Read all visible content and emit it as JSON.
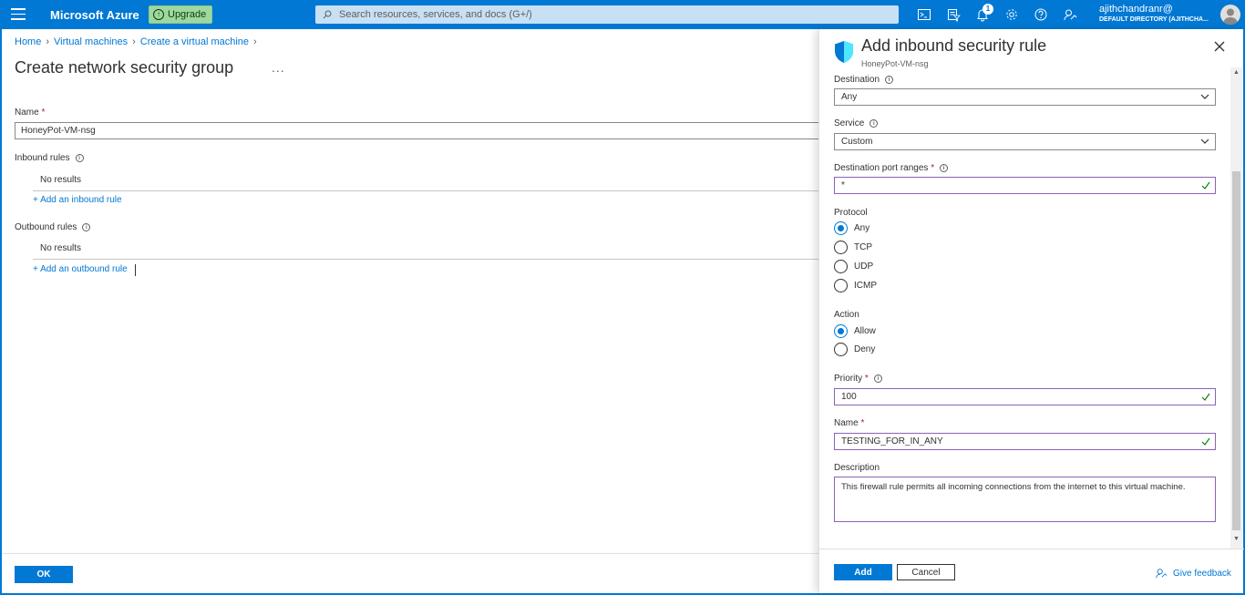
{
  "topbar": {
    "brand": "Microsoft Azure",
    "upgrade_label": "Upgrade",
    "search_placeholder": "Search resources, services, and docs (G+/)",
    "notification_count": "1",
    "user_name": "ajithchandranr@",
    "user_directory": "DEFAULT DIRECTORY (AJITHCHA..."
  },
  "main": {
    "breadcrumb": [
      "Home",
      "Virtual machines",
      "Create a virtual machine"
    ],
    "title": "Create network security group",
    "more": "...",
    "name_label": "Name",
    "name_required": "*",
    "name_value": "HoneyPot-VM-nsg",
    "inbound_label": "Inbound rules",
    "inbound_empty": "No results",
    "add_inbound": "+ Add an inbound rule",
    "outbound_label": "Outbound rules",
    "outbound_empty": "No results",
    "add_outbound": "+ Add an outbound rule",
    "ok_label": "OK"
  },
  "panel": {
    "title": "Add inbound security rule",
    "subtitle": "HoneyPot-VM-nsg",
    "destination_label": "Destination",
    "destination_value": "Any",
    "service_label": "Service",
    "service_value": "Custom",
    "port_label": "Destination port ranges",
    "port_value": "*",
    "protocol_label": "Protocol",
    "protocols": [
      "Any",
      "TCP",
      "UDP",
      "ICMP"
    ],
    "protocol_selected": "Any",
    "action_label": "Action",
    "actions": [
      "Allow",
      "Deny"
    ],
    "action_selected": "Allow",
    "priority_label": "Priority",
    "priority_value": "100",
    "name_label": "Name",
    "name_value": "TESTING_FOR_IN_ANY",
    "description_label": "Description",
    "description_value": "This firewall rule permits all incoming connections from the internet to this virtual machine.",
    "required_mark": "*",
    "info_mark": "i",
    "add_label": "Add",
    "cancel_label": "Cancel",
    "feedback_label": "Give feedback"
  },
  "colors": {
    "brand_blue": "#0078d4",
    "field_focus": "#8764b8",
    "valid_green": "#107c10",
    "upgrade_green": "#9fd89f"
  },
  "icons": [
    "menu-icon",
    "search-icon",
    "cloud-shell-icon",
    "directory-filter-icon",
    "notifications-icon",
    "settings-icon",
    "help-icon",
    "feedback-icon",
    "shield-icon",
    "close-icon",
    "info-icon",
    "chevron-down-icon",
    "checkmark-icon"
  ]
}
